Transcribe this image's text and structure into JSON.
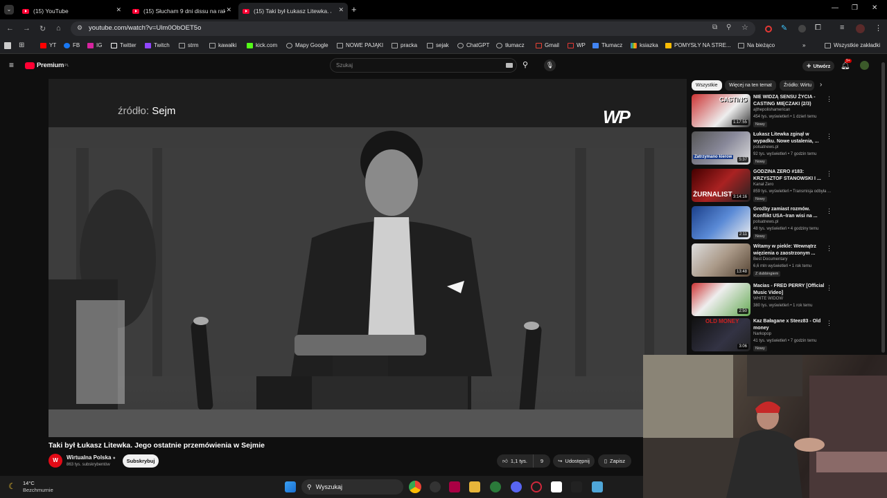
{
  "tabs": [
    {
      "title": "(15) YouTube"
    },
    {
      "title": "(15) Słucham 9 dni dissu na rak"
    },
    {
      "title": "(15) Taki był Łukasz Litewka. Jeg"
    }
  ],
  "address_bar": {
    "url": "youtube.com/watch?v=Ulm0ObOET5o"
  },
  "bookmarks": [
    "YT",
    "FB",
    "IG",
    "Twitter",
    "Twitch",
    "strm",
    "kawałki",
    "kick.com",
    "Mapy Google",
    "NOWE PAJĄKI",
    "pracka",
    "sejak",
    "ChatGPT",
    "tłumacz",
    "Gmail",
    "WP",
    "Tłumacz",
    "ksiazka",
    "POMYSŁY NA STRE...",
    "Na bieżąco",
    "Wszystkie zakładki"
  ],
  "youtube": {
    "logo": "Premium",
    "logo_sup": "PL",
    "search_placeholder": "Szukaj",
    "create_label": "Utwórz",
    "notif_count": "9+"
  },
  "video": {
    "overlay_prefix": "źródło:",
    "overlay_source": "Sejm",
    "watermark": "WP",
    "title": "Taki był Łukasz Litewka. Jego ostatnie przemówienia w Sejmie"
  },
  "channel": {
    "name": "Wirtualna Polska",
    "subs": "863 tys. subskrybentów",
    "subscribe_label": "Subskrybuj"
  },
  "actions": {
    "likes": "1,1 tys.",
    "dislikes": "9",
    "share": "Udostępnij",
    "save": "Zapisz"
  },
  "chips": [
    "Wszystkie",
    "Więcej na ten temat",
    "Źródło: Wirtu"
  ],
  "recommendations": [
    {
      "title": "NIE WIDZĄ SENSU ŻYCIA - CASTING MIĘCZAKI (2/3)",
      "channel": "ajthepolishamerican",
      "meta": "454 tys. wyświetleń • 1 dzień temu",
      "badge": "Nowy",
      "duration": "1:17:55",
      "thumb_text": "CASTING"
    },
    {
      "title": "Łukasz Litewka zginął w wypadku. Nowe ustalenia, ...",
      "channel": "polsatnews.pl",
      "meta": "92 tys. wyświetleń • 7 godzin temu",
      "badge": "Nowy",
      "duration": "5:37",
      "thumb_text": "Zatrzymano kierow"
    },
    {
      "title": "GODZINA ZERO #183: KRZYSZTOF STANOWSKI I ...",
      "channel": "Kanał Zero",
      "meta": "859 tys. wyświetleń • Transmisja odbyła ...",
      "badge": "Nowy",
      "duration": "3:14:16",
      "thumb_text": "ŻURNALIST"
    },
    {
      "title": "Groźby zamiast rozmów. Konflikt USA–Iran wisi na ...",
      "channel": "polsatnews.pl",
      "meta": "48 tys. wyświetleń • 4 godziny temu",
      "badge": "Nowy",
      "duration": "2:11",
      "thumb_text": ""
    },
    {
      "title": "Witamy w piekle: Wewnątrz więzienia o zaostrzonym ...",
      "channel": "Best Documentary",
      "meta": "6,6 mln wyświetleń • 1 rok temu",
      "badge": "Z dubbingiem",
      "duration": "13:48",
      "thumb_text": ""
    },
    {
      "title": "Macias - FRED PERRY [Official Music Video]",
      "channel": "WHITE WIDOW",
      "meta": "380 tys. wyświetleń • 1 rok temu",
      "badge": "",
      "duration": "2:50",
      "thumb_text": ""
    },
    {
      "title": "Kaz Bałagane x Steez83 - Old money",
      "channel": "Narkopop",
      "meta": "41 tys. wyświetleń • 7 godzin temu",
      "badge": "Nowy",
      "duration": "3:06",
      "thumb_text": "OLD MONEY"
    }
  ],
  "taskbar": {
    "weather_temp": "14°C",
    "weather_desc": "Bezchmurnie",
    "search_label": "Wyszukaj"
  },
  "colors": {
    "accent": "#ff0033",
    "bg": "#0f0f0f"
  }
}
